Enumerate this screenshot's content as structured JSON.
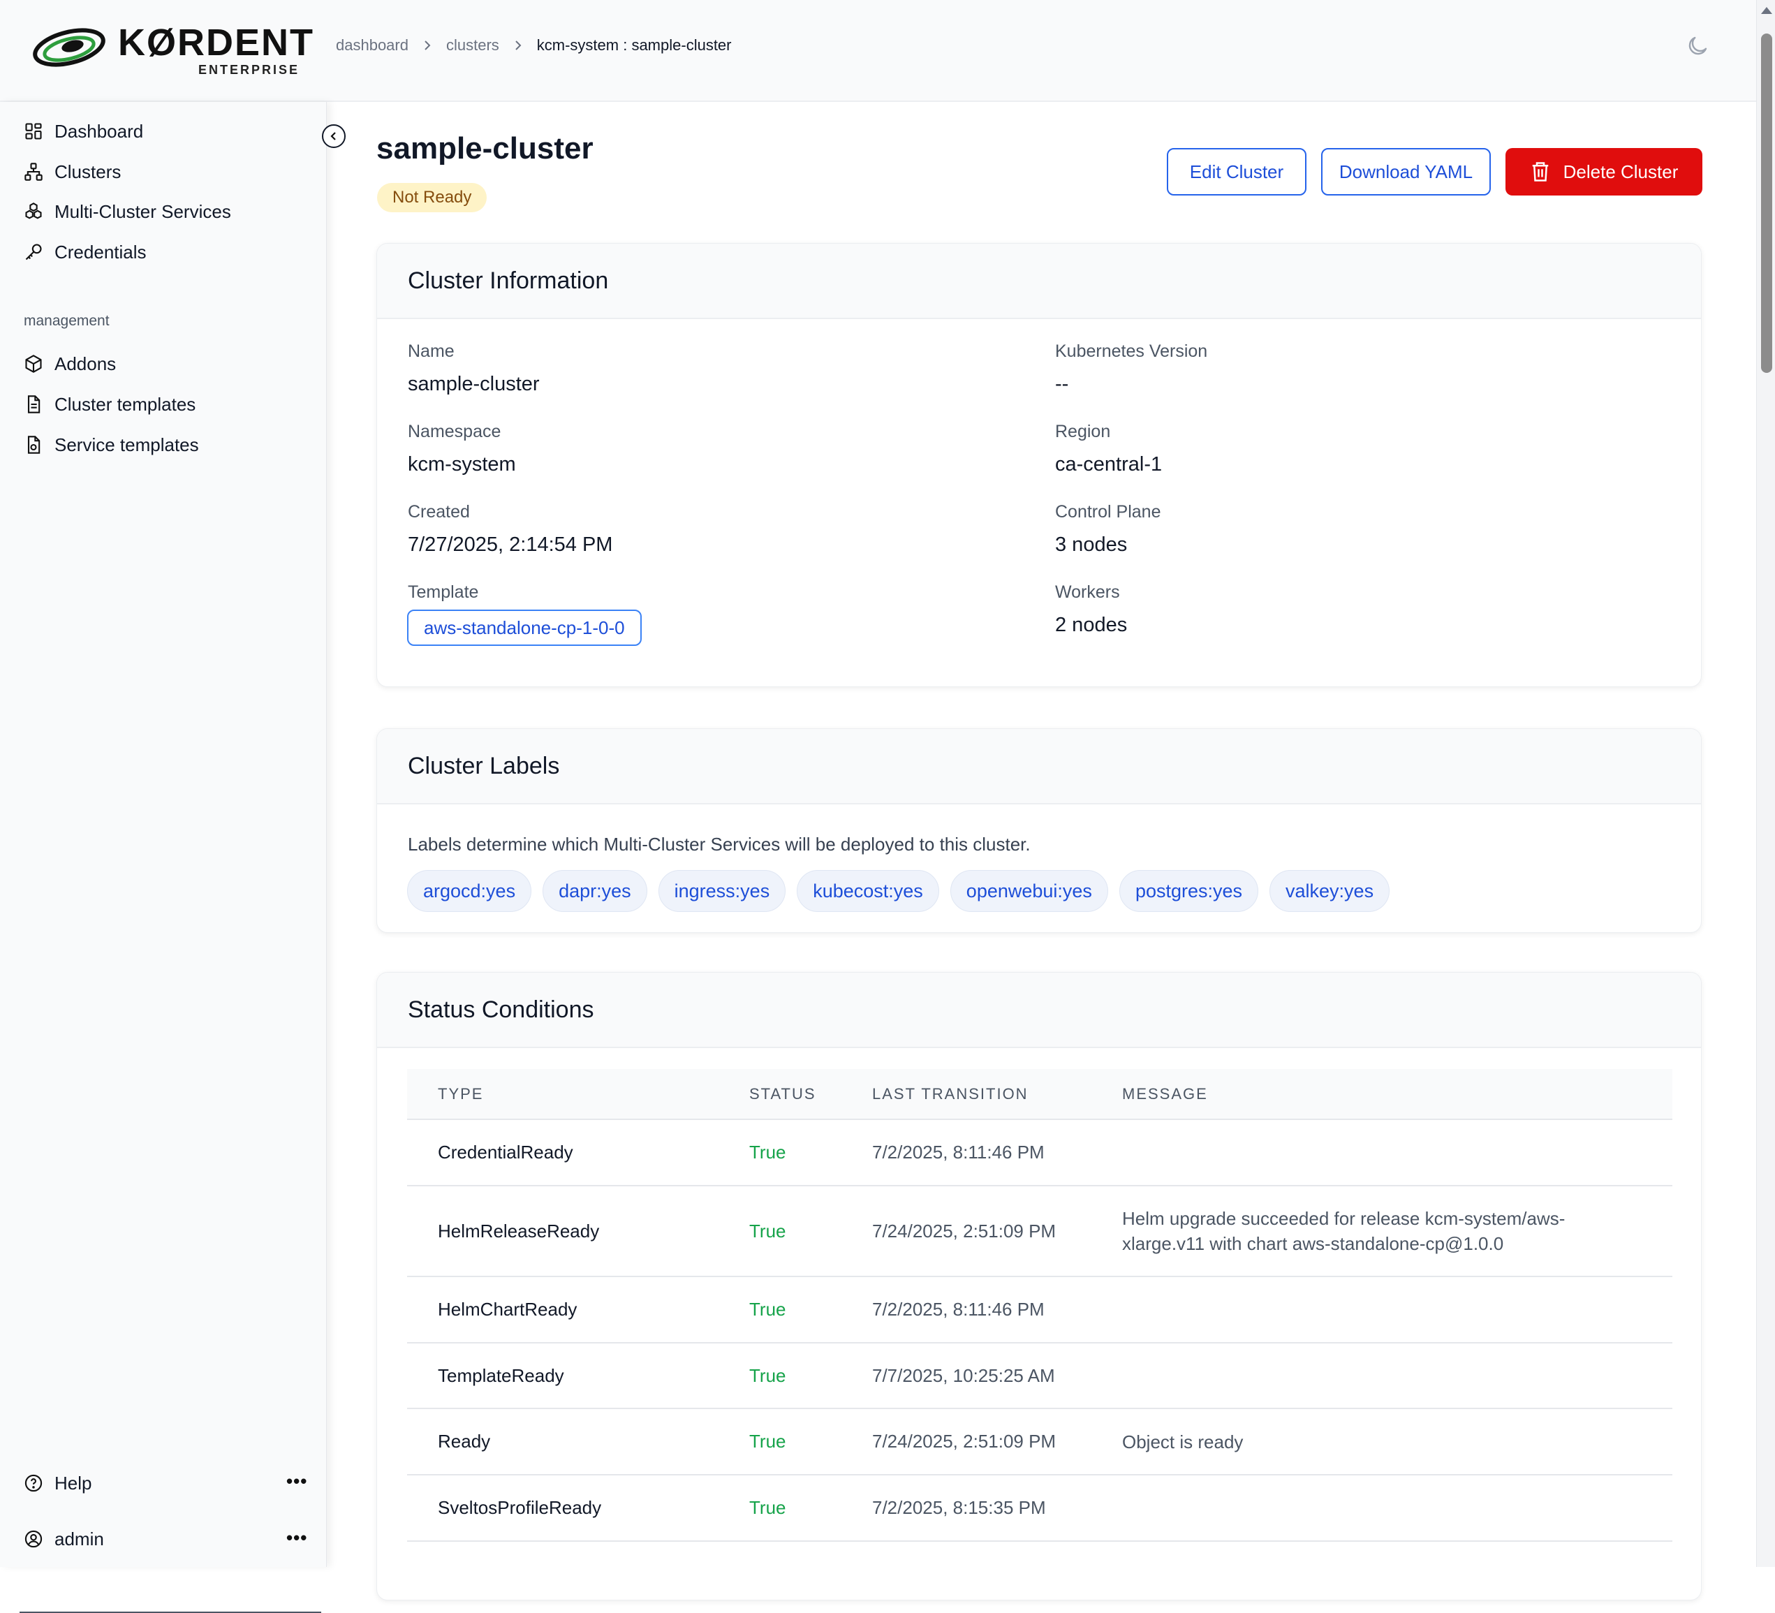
{
  "header": {
    "logo_word": "KØRDENT",
    "logo_sub": "ENTERPRISE",
    "breadcrumb": [
      "dashboard",
      "clusters",
      "kcm-system : sample-cluster"
    ]
  },
  "sidebar": {
    "items": [
      {
        "label": "Dashboard",
        "icon": "dashboard-icon"
      },
      {
        "label": "Clusters",
        "icon": "clusters-icon"
      },
      {
        "label": "Multi-Cluster Services",
        "icon": "services-icon"
      },
      {
        "label": "Credentials",
        "icon": "key-icon"
      }
    ],
    "section_label": "management",
    "management_items": [
      {
        "label": "Addons",
        "icon": "box-icon"
      },
      {
        "label": "Cluster templates",
        "icon": "document-icon"
      },
      {
        "label": "Service templates",
        "icon": "document-gear-icon"
      }
    ],
    "help_label": "Help",
    "user_label": "admin",
    "more_label": "•••"
  },
  "page": {
    "title": "sample-cluster",
    "status": "Not Ready",
    "actions": {
      "edit": "Edit Cluster",
      "download": "Download YAML",
      "delete": "Delete Cluster"
    }
  },
  "cluster_info": {
    "title": "Cluster Information",
    "name_label": "Name",
    "name": "sample-cluster",
    "namespace_label": "Namespace",
    "namespace": "kcm-system",
    "created_label": "Created",
    "created": "7/27/2025, 2:14:54 PM",
    "template_label": "Template",
    "template": "aws-standalone-cp-1-0-0",
    "k8s_label": "Kubernetes Version",
    "k8s": "--",
    "region_label": "Region",
    "region": "ca-central-1",
    "cp_label": "Control Plane",
    "cp": "3 nodes",
    "workers_label": "Workers",
    "workers": "2 nodes"
  },
  "cluster_labels": {
    "title": "Cluster Labels",
    "description": "Labels determine which Multi-Cluster Services will be deployed to this cluster.",
    "labels": [
      "argocd:yes",
      "dapr:yes",
      "ingress:yes",
      "kubecost:yes",
      "openwebui:yes",
      "postgres:yes",
      "valkey:yes"
    ]
  },
  "status_conditions": {
    "title": "Status Conditions",
    "columns": [
      "TYPE",
      "STATUS",
      "LAST TRANSITION",
      "MESSAGE"
    ],
    "rows": [
      {
        "type": "CredentialReady",
        "status": "True",
        "time": "7/2/2025, 8:11:46 PM",
        "message": ""
      },
      {
        "type": "HelmReleaseReady",
        "status": "True",
        "time": "7/24/2025, 2:51:09 PM",
        "message_line1": "Helm upgrade succeeded for release kcm-system/aws-",
        "message_line2": "xlarge.v11 with chart aws-standalone-cp@1.0.0"
      },
      {
        "type": "HelmChartReady",
        "status": "True",
        "time": "7/2/2025, 8:11:46 PM",
        "message": ""
      },
      {
        "type": "TemplateReady",
        "status": "True",
        "time": "7/7/2025, 10:25:25 AM",
        "message": ""
      },
      {
        "type": "Ready",
        "status": "True",
        "time": "7/24/2025, 2:51:09 PM",
        "message": "Object is ready"
      },
      {
        "type": "SveltosProfileReady",
        "status": "True",
        "time": "7/2/2025, 8:15:35 PM",
        "message": ""
      }
    ]
  },
  "colors": {
    "accent": "#1d4ed8",
    "danger": "#e00d0d",
    "success": "#16a34a",
    "warning_bg": "#fef3c7",
    "logo_green": "#2e9e3e"
  }
}
